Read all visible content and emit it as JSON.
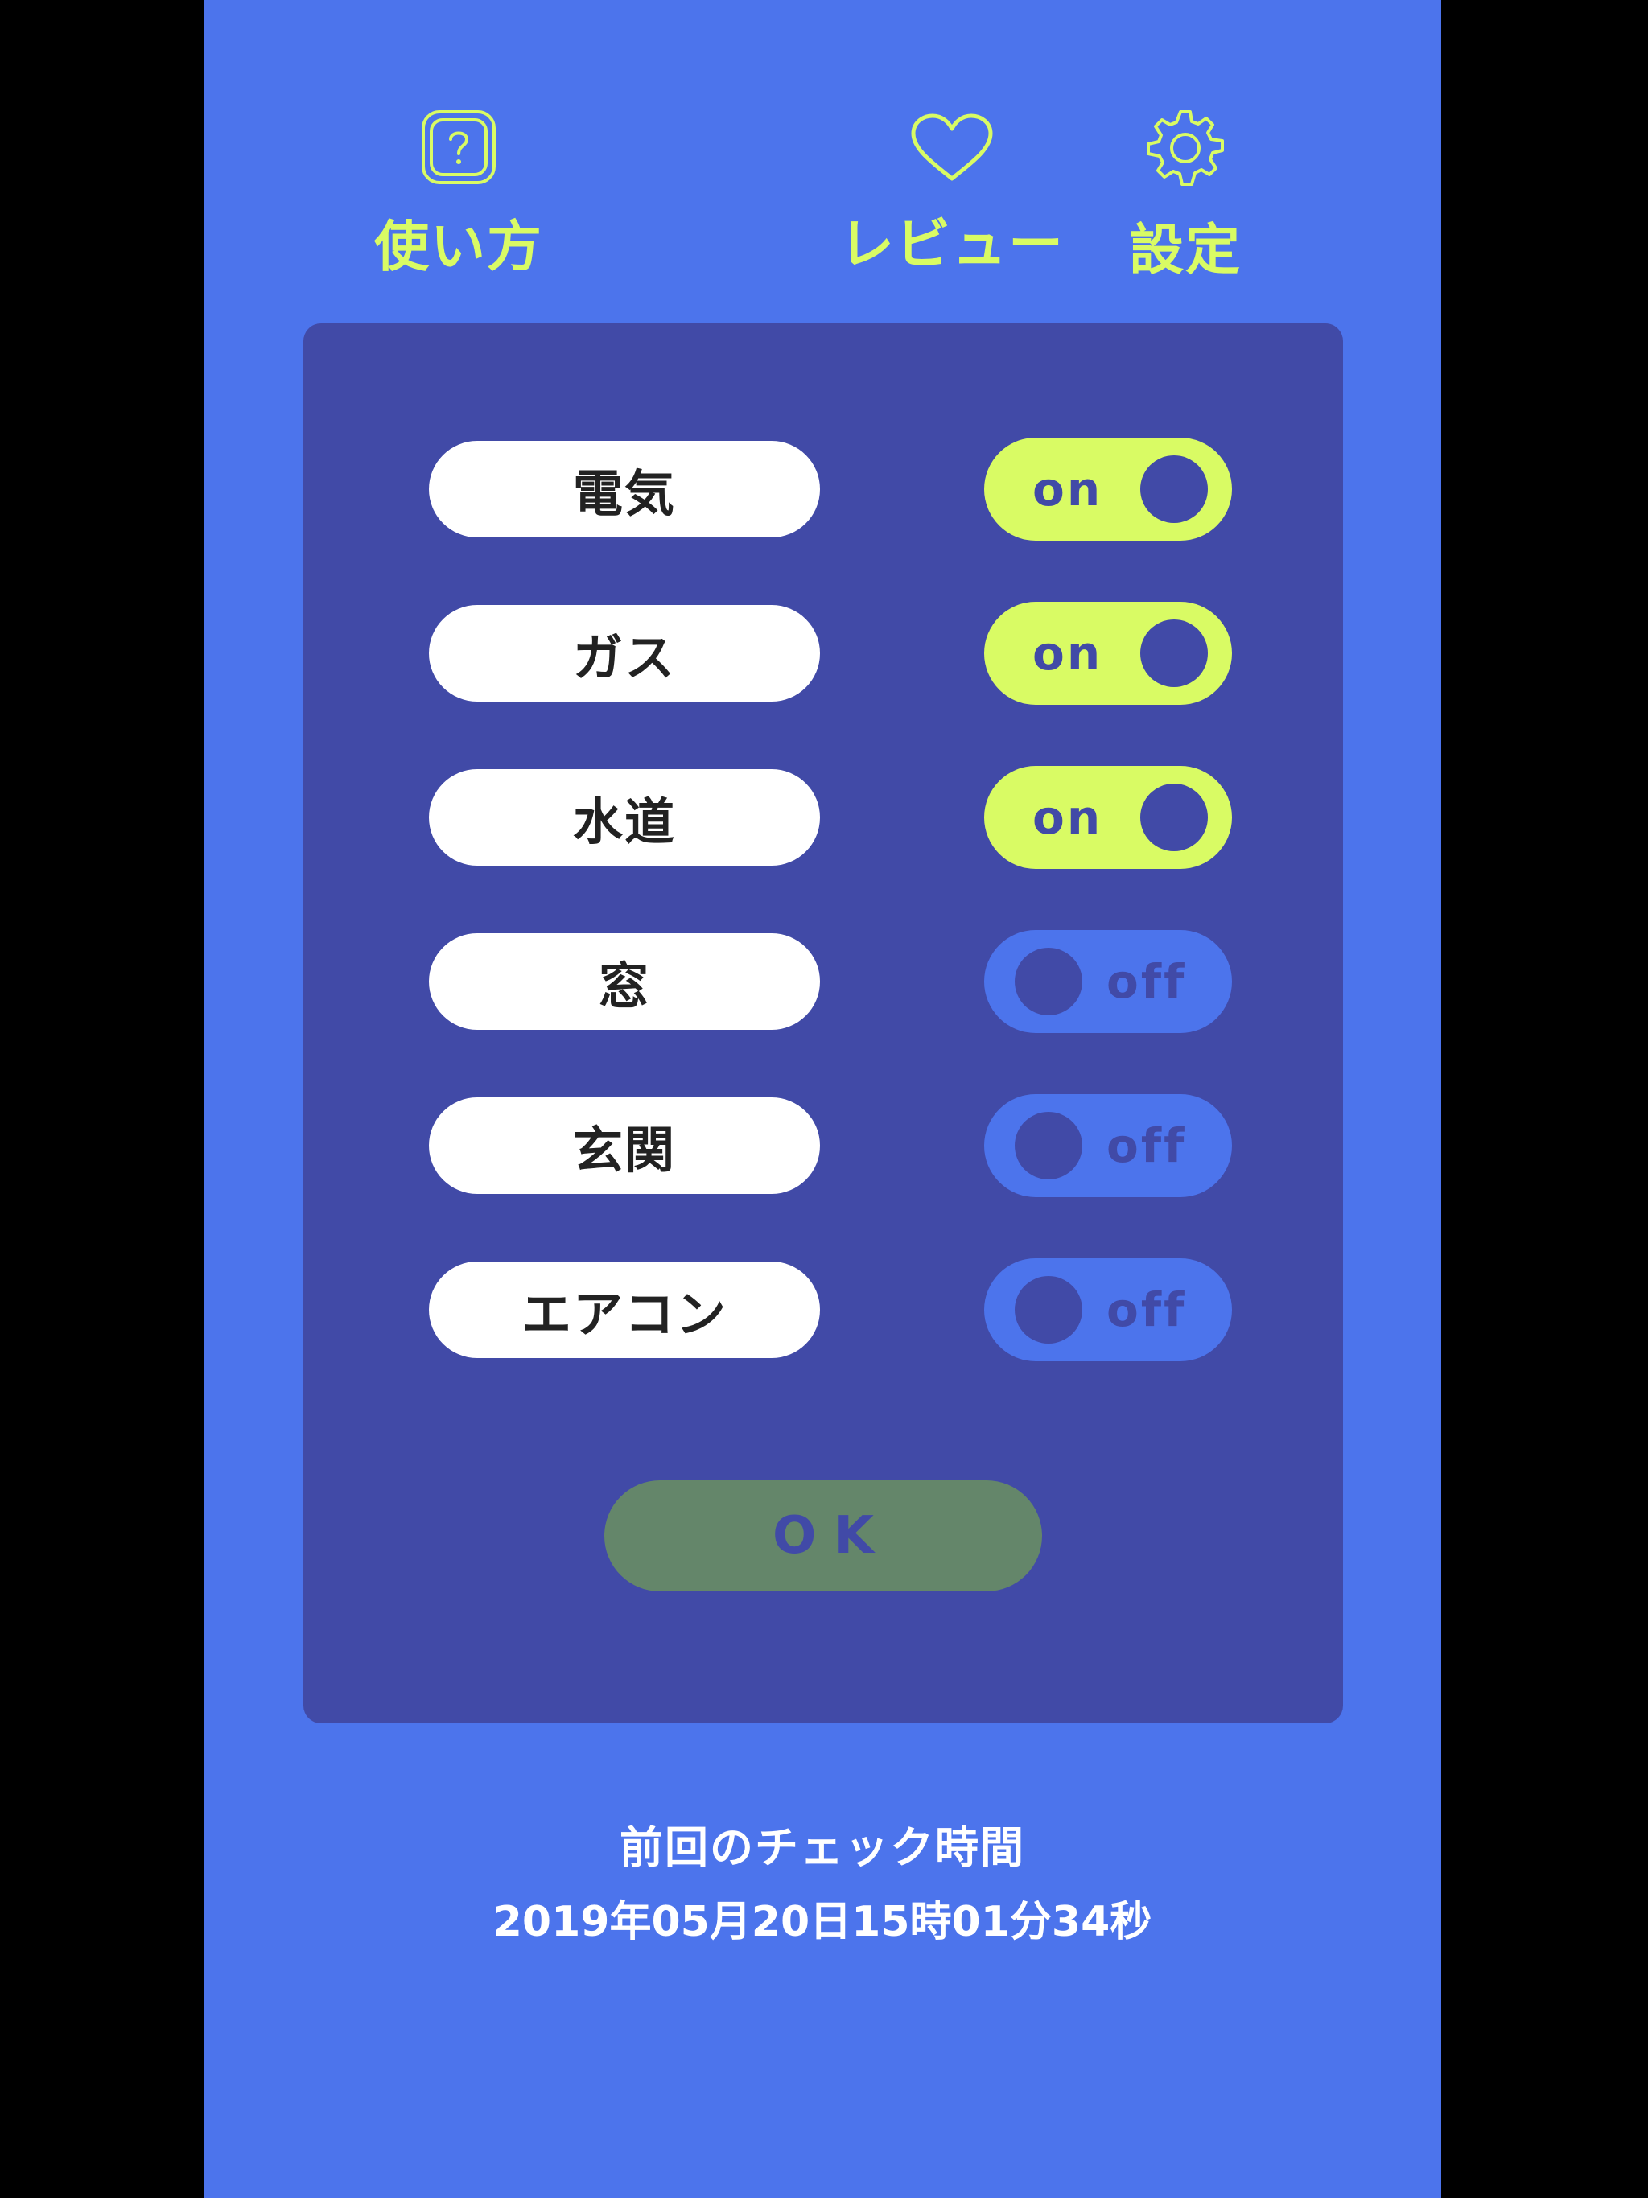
{
  "nav": {
    "howto": {
      "label": "使い方",
      "icon": "question-icon"
    },
    "review": {
      "label": "レビュー",
      "icon": "heart-icon"
    },
    "settings": {
      "label": "設定",
      "icon": "gear-icon"
    }
  },
  "items": [
    {
      "label": "電気",
      "state": "on"
    },
    {
      "label": "ガス",
      "state": "on"
    },
    {
      "label": "水道",
      "state": "on"
    },
    {
      "label": "窓",
      "state": "off"
    },
    {
      "label": "玄関",
      "state": "off"
    },
    {
      "label": "エアコン",
      "state": "off"
    }
  ],
  "ok_button": {
    "label": "OK"
  },
  "footer": {
    "title": "前回のチェック時間",
    "timestamp": "2019年05月20日15時01分34秒"
  },
  "colors": {
    "background": "#4c74ec",
    "panel": "#414aa7",
    "accent": "#d9fb64",
    "ok_button": "#64866a"
  }
}
